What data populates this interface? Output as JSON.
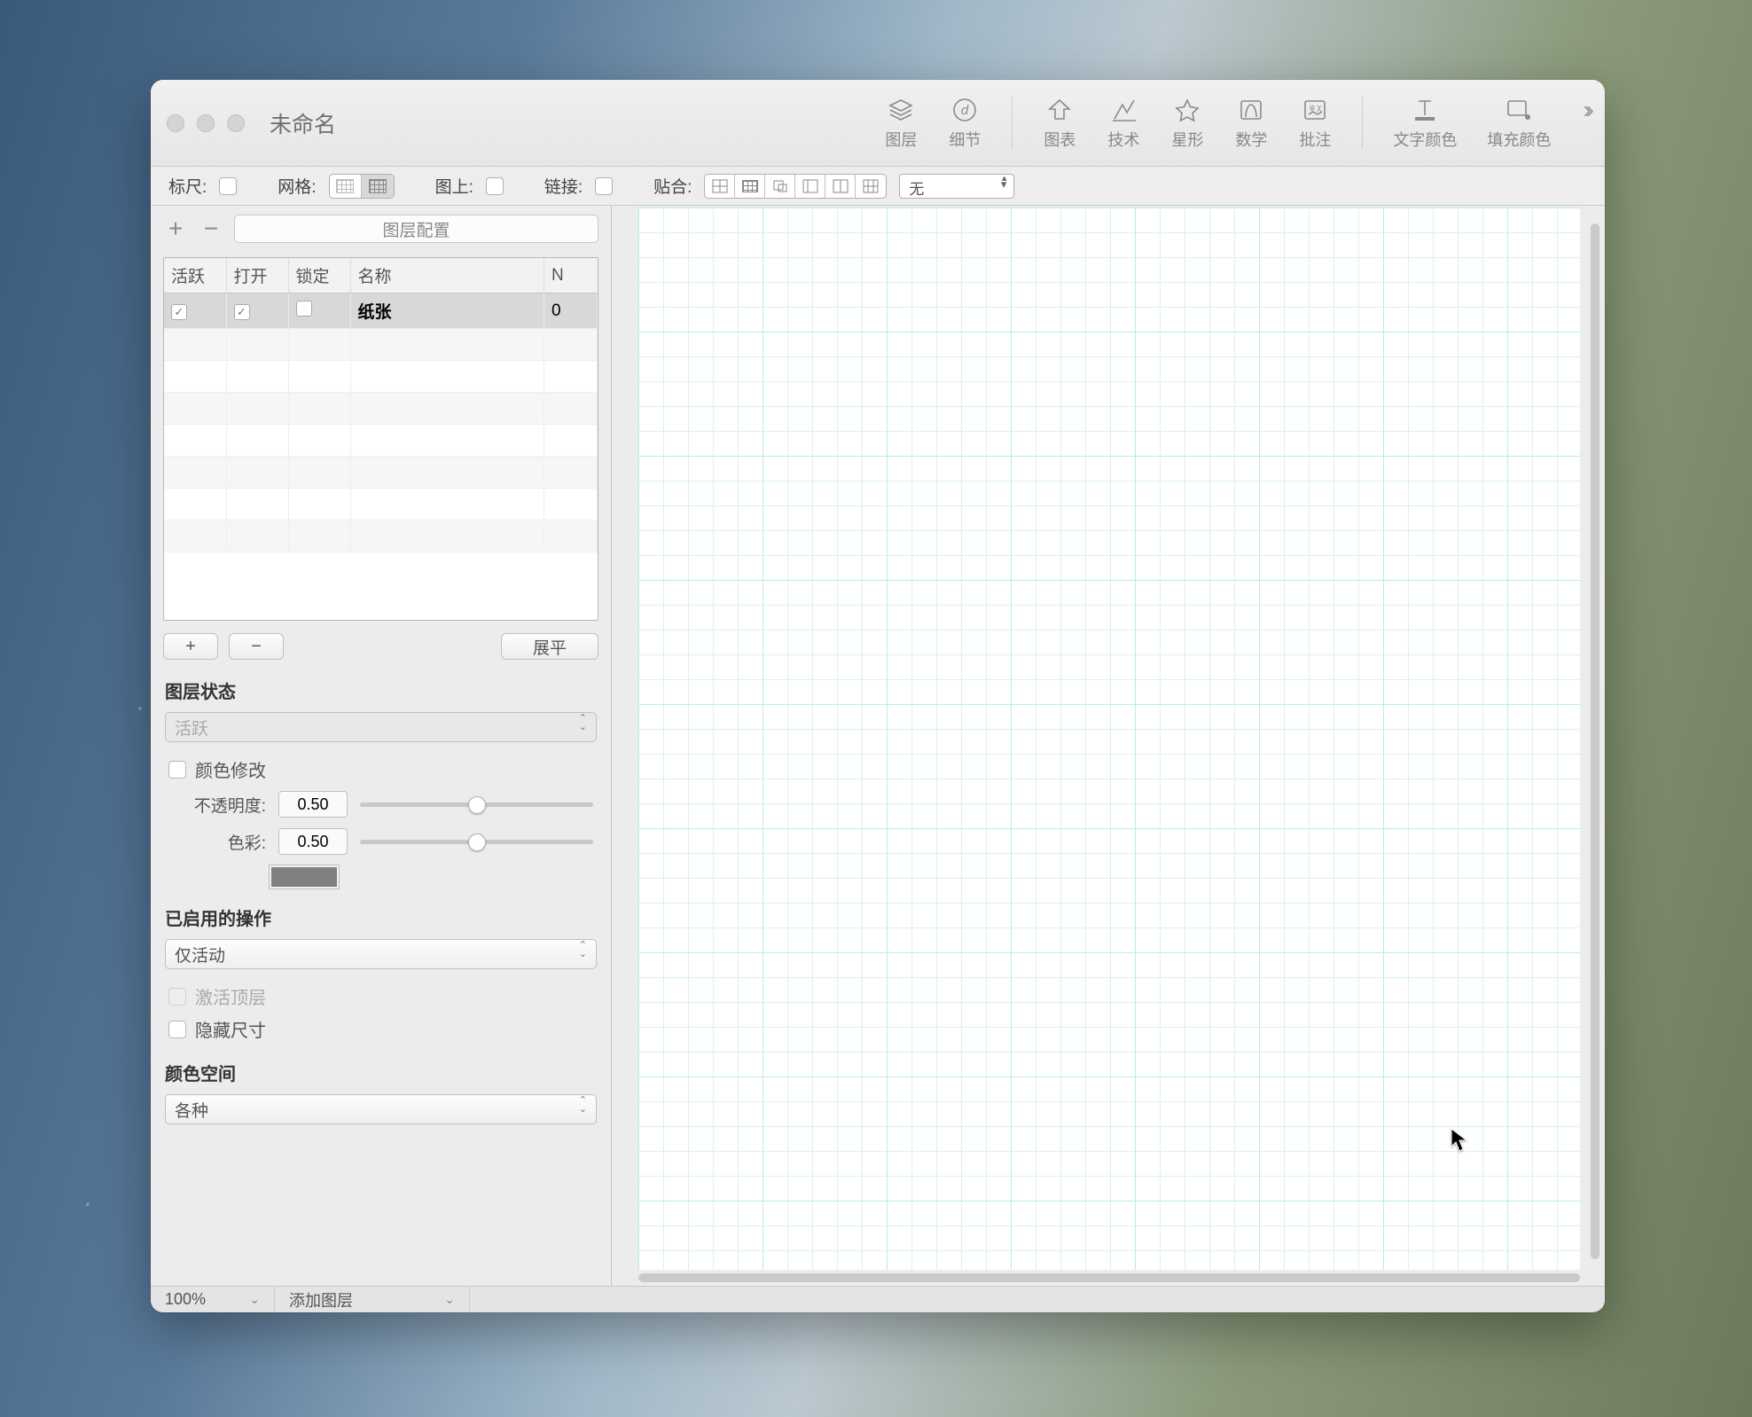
{
  "window": {
    "title": "未命名"
  },
  "toolbar": {
    "layers": "图层",
    "detail": "细节",
    "chart": "图表",
    "tech": "技术",
    "star": "星形",
    "math": "数学",
    "annot": "批注",
    "text_color": "文字颜色",
    "fill_color": "填充颜色"
  },
  "optbar": {
    "ruler": "标尺:",
    "grid": "网格:",
    "ontop": "图上:",
    "link": "链接:",
    "snap": "贴合:",
    "snap_select": "无"
  },
  "sidebar": {
    "layer_config": "图层配置",
    "table": {
      "headers": {
        "active": "活跃",
        "open": "打开",
        "lock": "锁定",
        "name": "名称",
        "n": "N"
      },
      "rows": [
        {
          "active": true,
          "open": true,
          "lock": false,
          "name": "纸张",
          "n": "0"
        }
      ]
    },
    "flatten": "展平",
    "layer_state": {
      "title": "图层状态",
      "value": "活跃"
    },
    "color_mod": "颜色修改",
    "opacity": {
      "label": "不透明度:",
      "value": "0.50",
      "pos": 50
    },
    "tint": {
      "label": "色彩:",
      "value": "0.50",
      "pos": 50
    },
    "enabled_ops": {
      "title": "已启用的操作",
      "value": "仅活动"
    },
    "activate_top": "激活顶层",
    "hide_dims": "隐藏尺寸",
    "color_space": {
      "title": "颜色空间",
      "value": "各种"
    }
  },
  "status": {
    "zoom": "100%",
    "add_layer": "添加图层"
  }
}
